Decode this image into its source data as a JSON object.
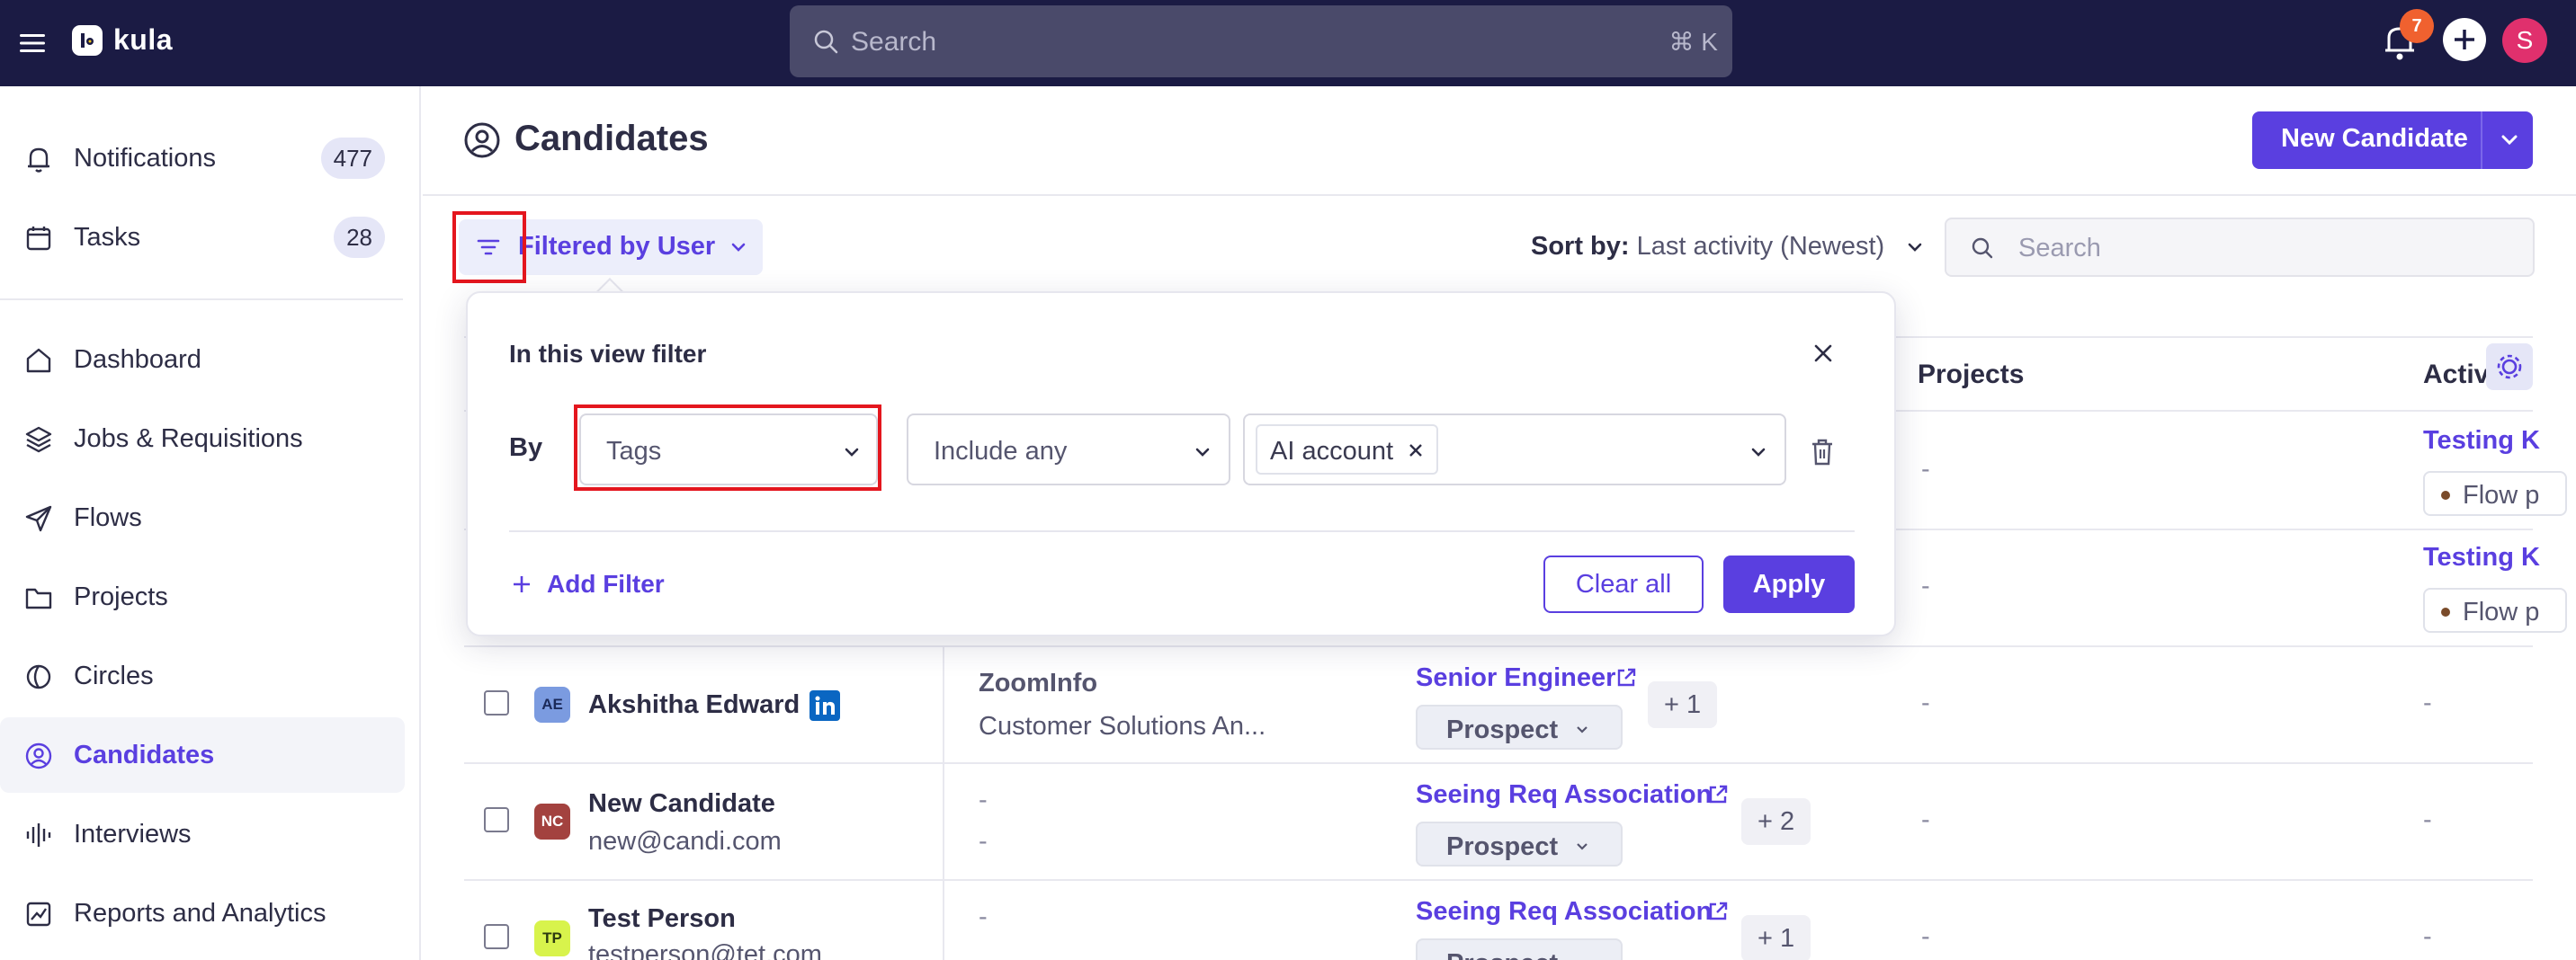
{
  "app": {
    "name": "kula"
  },
  "topbar": {
    "search_placeholder": "Search",
    "search_shortcut": "⌘ K",
    "notification_count": "7",
    "avatar_initial": "S"
  },
  "sidebar": {
    "items": [
      {
        "label": "Notifications",
        "count": "477"
      },
      {
        "label": "Tasks",
        "count": "28"
      },
      {
        "label": "Dashboard"
      },
      {
        "label": "Jobs & Requisitions"
      },
      {
        "label": "Flows"
      },
      {
        "label": "Projects"
      },
      {
        "label": "Circles"
      },
      {
        "label": "Candidates"
      },
      {
        "label": "Interviews"
      },
      {
        "label": "Reports and Analytics"
      }
    ],
    "active_index": 7
  },
  "page": {
    "title": "Candidates",
    "new_button": "New Candidate"
  },
  "toolbar": {
    "filter_label": "Filtered by User",
    "sort_label": "Sort by:",
    "sort_value": "Last activity (Newest)",
    "search_placeholder": "Search"
  },
  "table": {
    "headers": {
      "projects": "Projects",
      "activity": "Activi"
    },
    "rows": [
      {
        "projects": "-",
        "activity_link": "Testing K",
        "flow": "Flow p"
      },
      {
        "projects": "-",
        "activity_link": "Testing K",
        "flow": "Flow p"
      },
      {
        "initials": "AE",
        "name": "Akshitha Edward",
        "email": "",
        "company": "ZoomInfo",
        "role": "Customer Solutions An...",
        "job": "Senior Engineer",
        "stage": "Prospect",
        "more": "+ 1",
        "projects": "-",
        "activity": "-"
      },
      {
        "initials": "NC",
        "name": "New Candidate",
        "email": "new@candi.com",
        "company": "-",
        "role": "-",
        "job": "Seeing Req Association",
        "stage": "Prospect",
        "more": "+ 2",
        "projects": "-",
        "activity": "-"
      },
      {
        "initials": "TP",
        "name": "Test Person",
        "email": "testperson@tet.com",
        "company": "-",
        "role": "",
        "job": "Seeing Req Association",
        "stage": "Prospect",
        "more": "+ 1",
        "projects": "-",
        "activity": "-"
      }
    ]
  },
  "filter_popover": {
    "title": "In this view filter",
    "by_label": "By",
    "field": "Tags",
    "operator": "Include any",
    "selected_tags": [
      "AI account"
    ],
    "add_filter": "Add Filter",
    "clear_all": "Clear all",
    "apply": "Apply"
  },
  "colors": {
    "topbar": "#1b1b44",
    "accent": "#5a3fe0",
    "highlight": "#e4161e",
    "badge": "#f0612f",
    "avatar": "#e0306d"
  }
}
